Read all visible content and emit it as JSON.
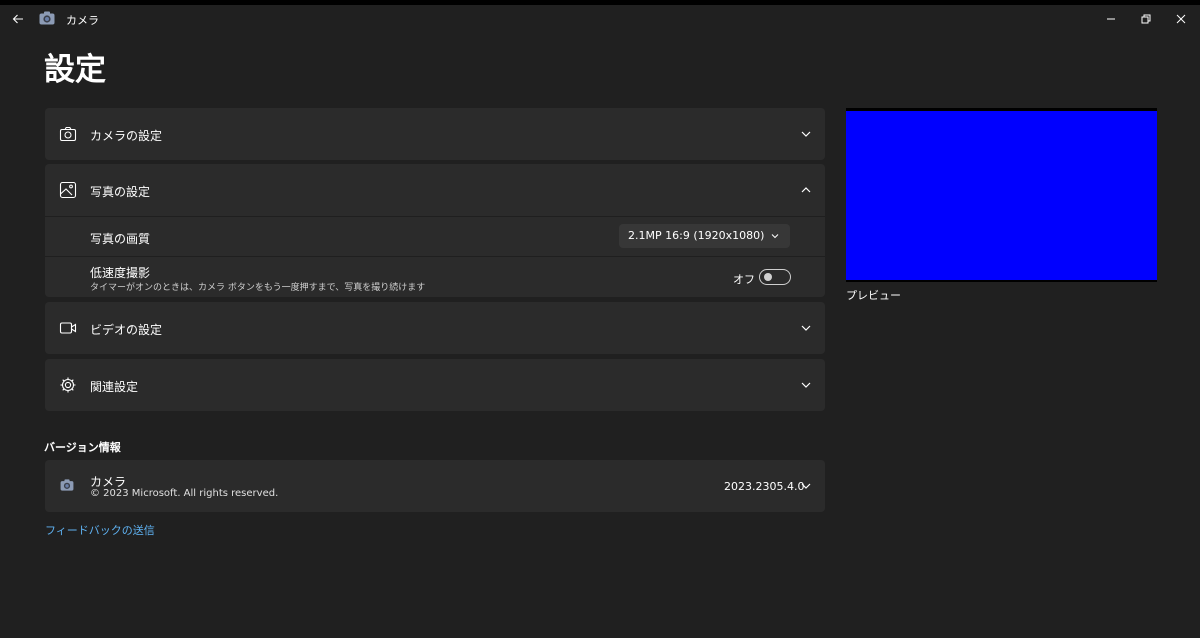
{
  "app": {
    "title": "カメラ"
  },
  "page": {
    "title": "設定"
  },
  "sections": {
    "camera": {
      "label": "カメラの設定"
    },
    "photo": {
      "label": "写真の設定",
      "quality": {
        "label": "写真の画質",
        "value": "2.1MP 16:9 (1920x1080)"
      },
      "lowlight": {
        "label": "低速度撮影",
        "description": "タイマーがオンのときは、カメラ ボタンをもう一度押すまで、写真を撮り続けます",
        "toggle_state": "オフ"
      }
    },
    "video": {
      "label": "ビデオの設定"
    },
    "related": {
      "label": "関連設定"
    }
  },
  "preview": {
    "label": "プレビュー",
    "color": "#0000ff"
  },
  "about": {
    "heading": "バージョン情報",
    "app_name": "カメラ",
    "copyright": "© 2023 Microsoft. All rights reserved.",
    "version": "2023.2305.4.0"
  },
  "feedback": {
    "label": "フィードバックの送信"
  },
  "colors": {
    "background": "#202020",
    "card": "#2b2b2b",
    "link": "#5fb2f2"
  }
}
